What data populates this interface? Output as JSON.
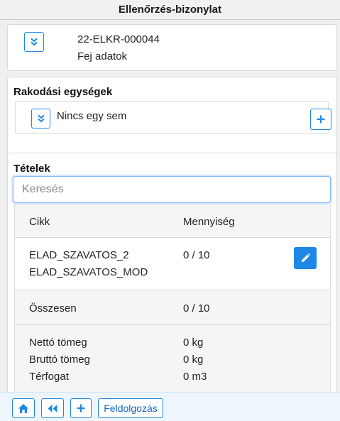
{
  "header": {
    "title": "Ellenőrzés-bizonylat"
  },
  "doc": {
    "number": "22-ELKR-000044",
    "subtitle": "Fej adatok",
    "expand_icon": "double-chevron-down-icon"
  },
  "units": {
    "title": "Rakodási egységek",
    "empty_text": "Nincs egy sem",
    "add_icon": "plus-icon"
  },
  "items": {
    "title": "Tételek",
    "search_placeholder": "Keresés",
    "columns": [
      "Cikk",
      "Mennyiség"
    ],
    "rows": [
      {
        "name_line1": "ELAD_SZAVATOS_2",
        "name_line2": "ELAD_SZAVATOS_MOD",
        "qty": "0 / 10"
      }
    ],
    "total_label": "Összesen",
    "total_qty": "0 / 10",
    "summary": [
      {
        "label": "Nettó tömeg",
        "value": "0 kg"
      },
      {
        "label": "Bruttó tömeg",
        "value": "0 kg"
      },
      {
        "label": "Térfogat",
        "value": "0 m3"
      }
    ]
  },
  "bottom": {
    "home_icon": "home-icon",
    "back_icon": "double-chevron-left-icon",
    "add_icon": "plus-icon",
    "process_label": "Feldolgozás"
  },
  "colors": {
    "accent": "#1e88e5",
    "background": "#efefef"
  }
}
